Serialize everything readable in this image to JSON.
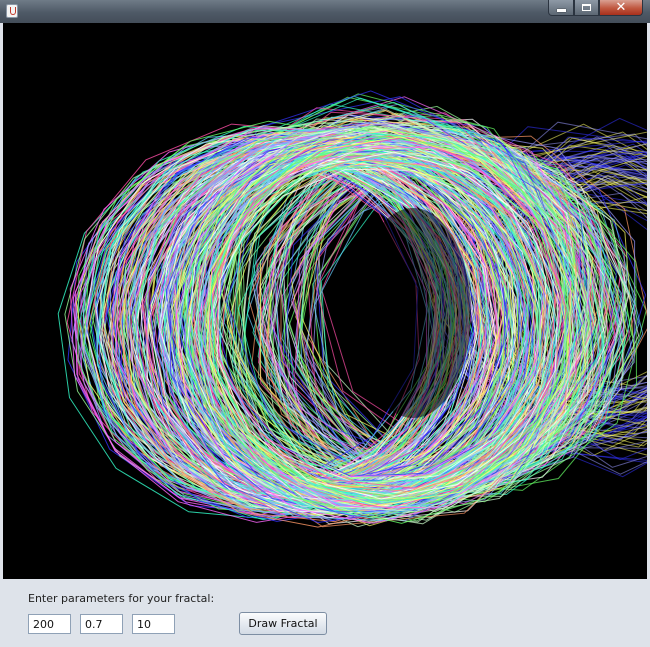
{
  "window": {
    "title": "",
    "controls": {
      "minimize_icon": "minimize-icon",
      "maximize_icon": "maximize-icon",
      "close_icon": "close-icon",
      "close_glyph": "✕"
    }
  },
  "canvas": {
    "background": "#000000",
    "palette": [
      "#ff4da6",
      "#ffff66",
      "#66ff66",
      "#66ccff",
      "#3333ff",
      "#ff66ff",
      "#99ff99",
      "#ff9966",
      "#ccffcc",
      "#9999ff",
      "#ffffff",
      "#33ffcc"
    ]
  },
  "controls": {
    "prompt": "Enter parameters for your fractal:",
    "fields": [
      {
        "name": "length",
        "value": "200"
      },
      {
        "name": "ratio",
        "value": "0.7"
      },
      {
        "name": "depth",
        "value": "10"
      }
    ],
    "draw_button": "Draw Fractal"
  }
}
